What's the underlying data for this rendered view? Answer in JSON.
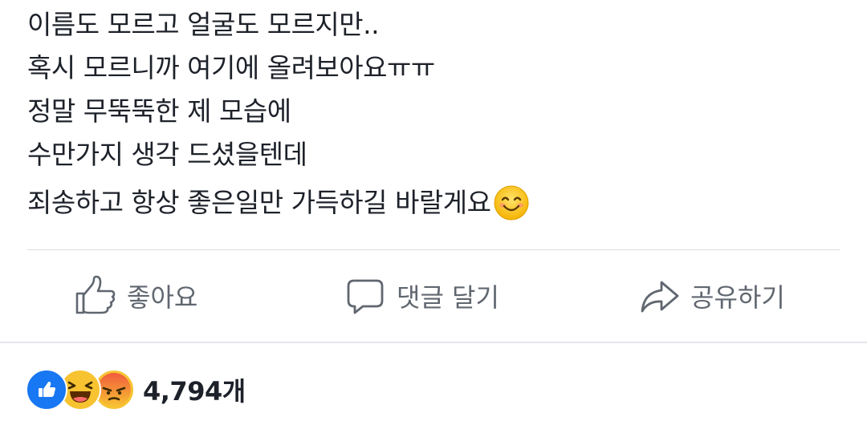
{
  "post": {
    "lines": [
      "이름도 모르고 얼굴도 모르지만..",
      "혹시 모르니까 여기에 올려보아요ㅠㅠ",
      "정말 무뚝뚝한 제 모습에",
      "수만가지 생각 드셨을텐데",
      "죄송하고 항상 좋은일만 가득하길 바랄게요"
    ],
    "trailing_emoji": "smiling-face-emoji"
  },
  "actions": {
    "like_label": "좋아요",
    "comment_label": "댓글 달기",
    "share_label": "공유하기"
  },
  "reactions": {
    "types": [
      "like",
      "haha",
      "angry"
    ],
    "count": "4,794개"
  },
  "colors": {
    "like_blue": "#1877f2",
    "emoji_yellow": "#f7c331",
    "angry_red": "#f15b3d",
    "action_gray": "#606770",
    "divider": "#dadde1"
  }
}
